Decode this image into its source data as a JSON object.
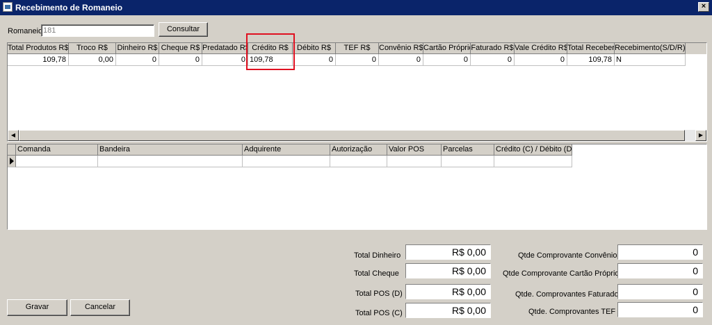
{
  "window": {
    "title": "Recebimento de Romaneio",
    "close_label": "×"
  },
  "romaneio": {
    "label": "Romaneio",
    "value": "181",
    "consultar_label": "Consultar"
  },
  "grid1": {
    "columns": [
      "Total Produtos R$",
      "Troco R$",
      "Dinheiro R$",
      "Cheque R$",
      "Predatado R$",
      "Crédito R$",
      "Débito R$",
      "TEF R$",
      "Convênio R$",
      "Cartão Próprio",
      "Faturado R$",
      "Vale Crédito R$",
      "Total Receber",
      "Recebimento(S/D/R)"
    ],
    "row": [
      "109,78",
      "0,00",
      "0",
      "0",
      "0",
      "109,78",
      "0",
      "0",
      "0",
      "0",
      "0",
      "0",
      "109,78",
      "N"
    ]
  },
  "grid2": {
    "columns": [
      "Comanda",
      "Bandeira",
      "Adquirente",
      "Autorização",
      "Valor POS",
      "Parcelas",
      "Crédito (C) / Débito (D)"
    ]
  },
  "totals_left": [
    {
      "label": "Total Dinheiro",
      "value": "R$ 0,00"
    },
    {
      "label": "Total Cheque",
      "value": "R$ 0,00"
    },
    {
      "label": "Total POS (D)",
      "value": "R$ 0,00"
    },
    {
      "label": "Total POS (C)",
      "value": "R$ 0,00"
    }
  ],
  "totals_right": [
    {
      "label": "Qtde Comprovante Convênio",
      "value": "0"
    },
    {
      "label": "Qtde Comprovante Cartão Próprio",
      "value": "0"
    },
    {
      "label": "Qtde. Comprovantes Faturado",
      "value": "0"
    },
    {
      "label": "Qtde. Comprovantes TEF",
      "value": "0"
    }
  ],
  "buttons": {
    "gravar": "Gravar",
    "cancelar": "Cancelar"
  },
  "colors": {
    "titlebar": "#0a246a",
    "window_bg": "#d4d0c8",
    "highlight": "#e01020"
  }
}
